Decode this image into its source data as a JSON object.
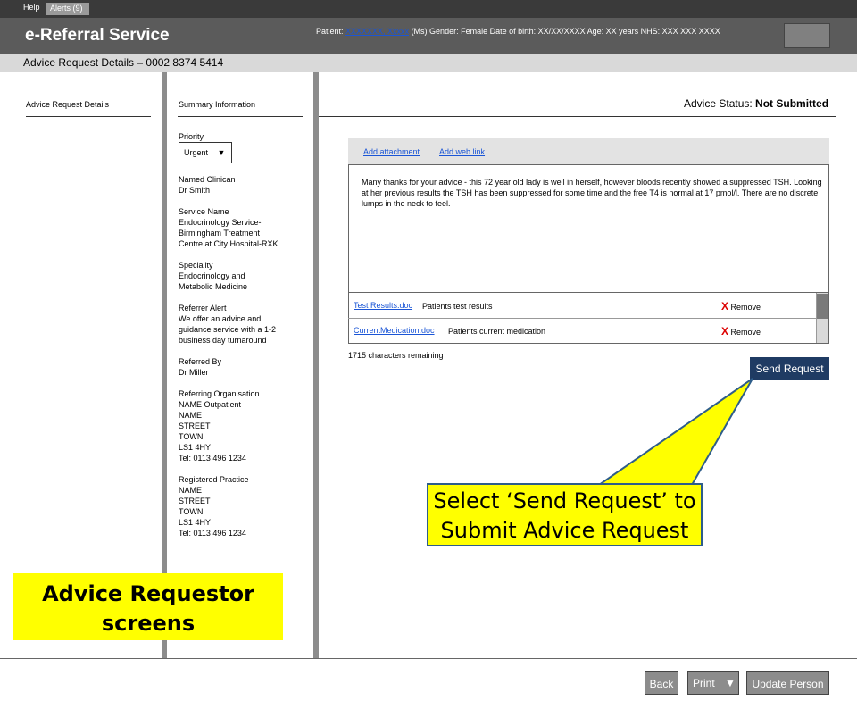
{
  "top": {
    "help": "Help",
    "alerts": "Alerts (9)"
  },
  "header": {
    "title": "e-Referral Service",
    "patient_prefix": "Patient: ",
    "patient_name": "XXXXXXX, Xxxxx",
    "patient_details": " (Ms) Gender: Female Date of birth: XX/XX/XXXX Age: XX years NHS: XXX XXX XXXX"
  },
  "subheader": "Advice Request Details – 0002 8374 5414",
  "left_nav": {
    "item": "Advice Request Details"
  },
  "summary": {
    "heading": "Summary Information",
    "priority_label": "Priority",
    "priority_value": "Urgent",
    "priority_arrow": "▼",
    "fields": [
      {
        "label": "Named Clinican",
        "value": "Dr Smith"
      },
      {
        "label": "Service Name",
        "value": "Endocrinology Service-\nBirmingham Treatment\nCentre at City Hospital-RXK"
      },
      {
        "label": "Speciality",
        "value": "Endocrinology and\nMetabolic Medicine"
      },
      {
        "label": "Referrer Alert",
        "value": "We offer an advice and\nguidance service with a 1-2\nbusiness day turnaround"
      },
      {
        "label": "Referred By",
        "value": "Dr Miller"
      },
      {
        "label": "Referring Organisation",
        "value": "NAME Outpatient\nNAME\nSTREET\nTOWN\nLS1 4HY\nTel: 0113 496 1234"
      },
      {
        "label": "Registered Practice",
        "value": "NAME\nSTREET\nTOWN\nLS1 4HY\nTel: 0113 496 1234"
      }
    ]
  },
  "main": {
    "status_label": "Advice Status: ",
    "status_value": "Not Submitted",
    "add_attachment": "Add attachment",
    "add_web_link": "Add web link",
    "message": "Many thanks for your advice - this 72 year old lady is well in herself, however bloods recently showed a suppressed TSH. Looking at her previous results the TSH has been suppressed for some time and the free T4 is normal at 17 pmol/l. There are no discrete lumps in the neck to feel.",
    "attachments": [
      {
        "file": "Test Results.doc",
        "description": "Patients test results",
        "remove": "Remove"
      },
      {
        "file": "CurrentMedication.doc",
        "description": "Patients current medication",
        "remove": "Remove"
      }
    ],
    "remove_mark": "X",
    "chars_remaining": "1715 characters remaining",
    "send_button": "Send Request"
  },
  "callouts": {
    "send": "Select ‘Send Request’ to\nSubmit Advice Request",
    "requestor": "Advice Requestor\nscreens"
  },
  "footer": {
    "back": "Back",
    "print": "Print",
    "print_arrow": "▼",
    "update": "Update Person"
  }
}
